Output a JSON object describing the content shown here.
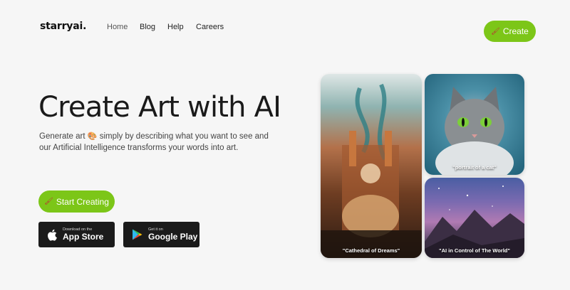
{
  "nav": {
    "logo": "starryai",
    "logo_dot": ".",
    "links": [
      "Home",
      "Blog",
      "Help",
      "Careers"
    ],
    "create_label": "Create"
  },
  "hero": {
    "title": "Create Art with AI",
    "desc_part1": "Generate art",
    "desc_part2": "simply by describing what you want to see and our Artificial Intelligence transforms your words into art.",
    "start_label": "Start Creating"
  },
  "stores": {
    "apple_small": "Download on the",
    "apple_big": "App Store",
    "google_small": "Get it on",
    "google_big": "Google Play"
  },
  "gallery": {
    "cathedral_caption": "\"Cathedral of Dreams\"",
    "cat_caption": "\"portrait of a cat\"",
    "space_caption": "\"AI in Control of The World\""
  },
  "colors": {
    "accent": "#7cc618",
    "background": "#f6f6f6",
    "store_bg": "#1b1b1b"
  }
}
